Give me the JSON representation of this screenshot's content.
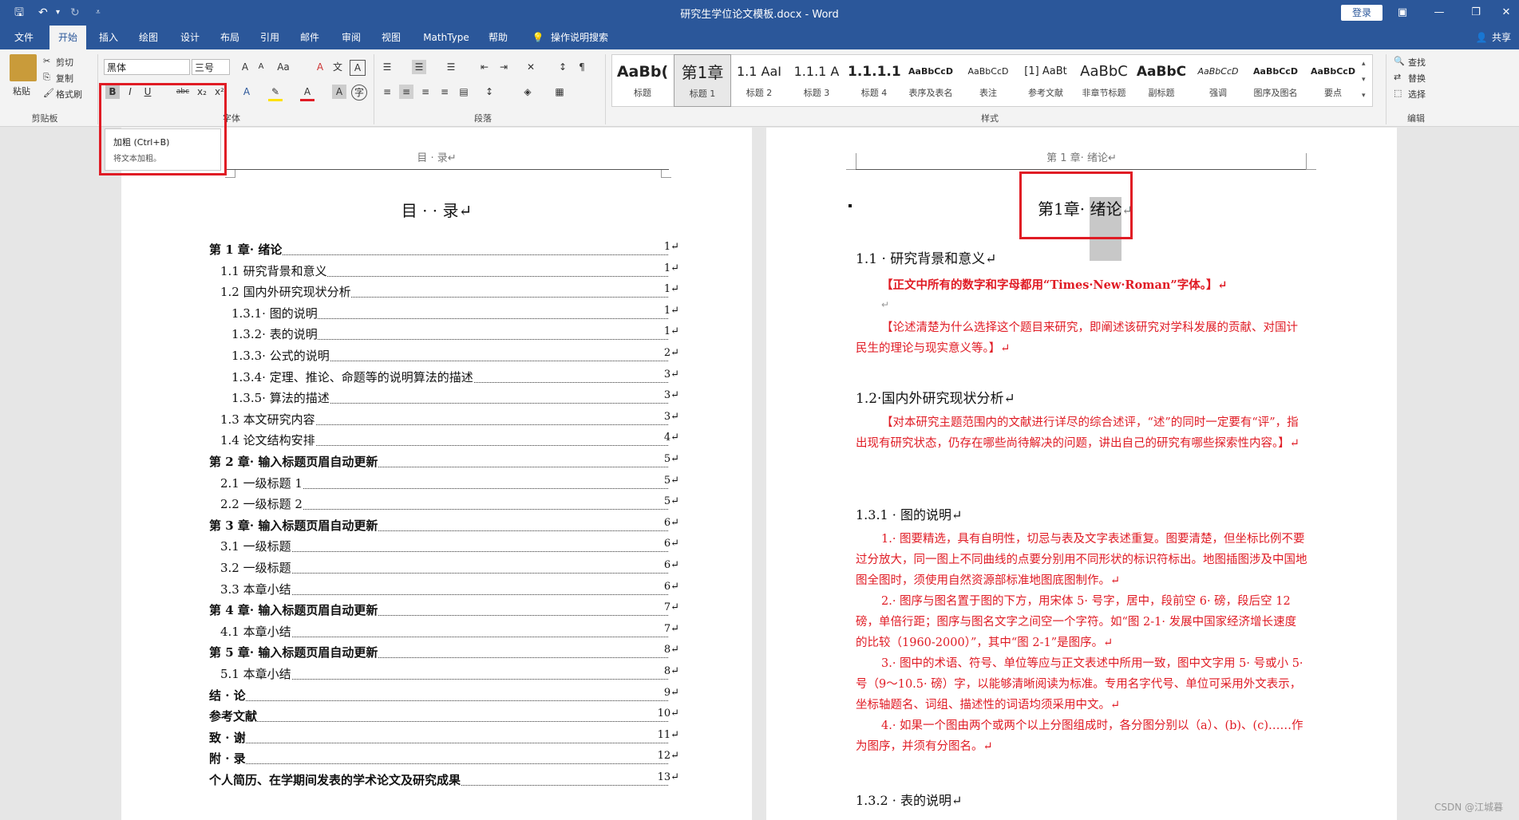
{
  "titlebar": {
    "doc_title": "研究生学位论文模板.docx  -  Word",
    "login": "登录",
    "save_icon": "save-icon",
    "undo_icon": "undo-icon",
    "redo_icon": "redo-icon"
  },
  "tabs": [
    "文件",
    "开始",
    "插入",
    "绘图",
    "设计",
    "布局",
    "引用",
    "邮件",
    "审阅",
    "视图",
    "MathType",
    "帮助"
  ],
  "tell_me": "操作说明搜索",
  "share": "共享",
  "clipboard": {
    "paste": "粘贴",
    "cut": "剪切",
    "copy": "复制",
    "format_painter": "格式刷",
    "label": "剪贴板"
  },
  "font": {
    "name": "黑体",
    "size": "三号",
    "label": "字体"
  },
  "paragraph": {
    "label": "段落"
  },
  "styles": {
    "label": "样式",
    "items": [
      {
        "preview": "AaBb(",
        "name": "标题"
      },
      {
        "preview": "第1章",
        "name": "标题 1"
      },
      {
        "preview": "1.1 AaI",
        "name": "标题 2"
      },
      {
        "preview": "1.1.1 A",
        "name": "标题 3"
      },
      {
        "preview": "1.1.1.1",
        "name": "标题 4"
      },
      {
        "preview": "AaBbCcD",
        "name": "表序及表名"
      },
      {
        "preview": "AaBbCcD",
        "name": "表注"
      },
      {
        "preview": "[1] AaBt",
        "name": "参考文献"
      },
      {
        "preview": "AaBbC",
        "name": "非章节标题"
      },
      {
        "preview": "AaBbC",
        "name": "副标题"
      },
      {
        "preview": "AaBbCcD",
        "name": "强调"
      },
      {
        "preview": "AaBbCcD",
        "name": "图序及图名"
      },
      {
        "preview": "AaBbCcD",
        "name": "要点"
      }
    ]
  },
  "editing": {
    "find": "查找",
    "replace": "替换",
    "select": "选择",
    "label": "编辑"
  },
  "tooltip": {
    "title": "加粗 (Ctrl+B)",
    "desc": "将文本加粗。"
  },
  "left_page": {
    "header": "目 · 录↵",
    "title": "目 · · 录↵",
    "toc": [
      {
        "text": "第 1 章· 绪论",
        "page": "1↵",
        "level": 1
      },
      {
        "text": "1.1 研究背景和意义",
        "page": "1↵",
        "level": 2
      },
      {
        "text": "1.2 国内外研究现状分析",
        "page": "1↵",
        "level": 2
      },
      {
        "text": "1.3.1· 图的说明",
        "page": "1↵",
        "level": 3
      },
      {
        "text": "1.3.2· 表的说明",
        "page": "1↵",
        "level": 3
      },
      {
        "text": "1.3.3· 公式的说明",
        "page": "2↵",
        "level": 3
      },
      {
        "text": "1.3.4· 定理、推论、命题等的说明算法的描述",
        "page": "3↵",
        "level": 3
      },
      {
        "text": "1.3.5· 算法的描述",
        "page": "3↵",
        "level": 3
      },
      {
        "text": "1.3 本文研究内容",
        "page": "3↵",
        "level": 2
      },
      {
        "text": "1.4 论文结构安排",
        "page": "4↵",
        "level": 2
      },
      {
        "text": "第 2 章· 输入标题页眉自动更新",
        "page": "5↵",
        "level": 1
      },
      {
        "text": "2.1 一级标题 1",
        "page": "5↵",
        "level": 2
      },
      {
        "text": "2.2 一级标题 2",
        "page": "5↵",
        "level": 2
      },
      {
        "text": "第 3 章· 输入标题页眉自动更新",
        "page": "6↵",
        "level": 1
      },
      {
        "text": "3.1 一级标题",
        "page": "6↵",
        "level": 2
      },
      {
        "text": "3.2 一级标题",
        "page": "6↵",
        "level": 2
      },
      {
        "text": "3.3 本章小结",
        "page": "6↵",
        "level": 2
      },
      {
        "text": "第 4 章· 输入标题页眉自动更新",
        "page": "7↵",
        "level": 1
      },
      {
        "text": "4.1 本章小结",
        "page": "7↵",
        "level": 2
      },
      {
        "text": "第 5 章· 输入标题页眉自动更新",
        "page": "8↵",
        "level": 1
      },
      {
        "text": "5.1 本章小结",
        "page": "8↵",
        "level": 2
      },
      {
        "text": "结 · 论",
        "page": "9↵",
        "level": 1
      },
      {
        "text": "参考文献",
        "page": "10↵",
        "level": 1
      },
      {
        "text": "致 · 谢",
        "page": "11↵",
        "level": 1
      },
      {
        "text": "附 · 录",
        "page": "12↵",
        "level": 1
      },
      {
        "text": "个人简历、在学期间发表的学术论文及研究成果",
        "page": "13↵",
        "level": 1
      }
    ]
  },
  "right_page": {
    "header": "第 1 章· 绪论↵",
    "chapter_title_a": "第1章· ",
    "chapter_title_b": "绪论",
    "chapter_mark": "↵",
    "h11": "1.1 · 研究背景和意义↵",
    "note1": "【正文中所有的数字和字母都用“Times·New·Roman”字体。】↵",
    "empty": "↵",
    "para1": "【论述清楚为什么选择这个题目来研究，即阐述该研究对学科发展的贡献、对国计民生的理论与现实意义等。】↵",
    "h12": "1.2·国内外研究现状分析↵",
    "para2": "【对本研究主题范围内的文献进行详尽的综合述评，“述”的同时一定要有“评”，指出现有研究状态，仍存在哪些尚待解决的问题，讲出自己的研究有哪些探索性内容。】↵",
    "h131": "1.3.1 · 图的说明↵",
    "item1": "1.· 图要精选，具有自明性，切忌与表及文字表述重复。图要清楚，但坐标比例不要过分放大，同一图上不同曲线的点要分别用不同形状的标识符标出。地图插图涉及中国地图全图时，须使用自然资源部标准地图底图制作。↵",
    "item2": "2.· 图序与图名置于图的下方，用宋体 5· 号字，居中，段前空 6· 磅，段后空 12 磅，单倍行距；图序与图名文字之间空一个字符。如“图 2-1· 发展中国家经济增长速度的比较（1960-2000）”，其中“图 2-1”是图序。↵",
    "item3": "3.· 图中的术语、符号、单位等应与正文表述中所用一致，图中文字用 5· 号或小 5· 号（9～10.5· 磅）字，以能够清晰阅读为标准。专用名字代号、单位可采用外文表示，坐标轴题名、词组、描述性的词语均须采用中文。↵",
    "item4": "4.· 如果一个图由两个或两个以上分图组成时，各分图分别以（a）、(b)、(c)……作为图序，并须有分图名。↵",
    "h132": "1.3.2 · 表的说明↵"
  },
  "watermark": "CSDN @江城暮"
}
